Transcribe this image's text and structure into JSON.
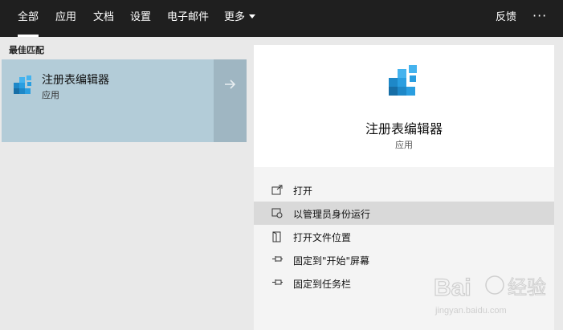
{
  "nav": {
    "tabs": [
      "全部",
      "应用",
      "文档",
      "设置",
      "电子邮件",
      "更多"
    ],
    "feedback": "反馈",
    "more_options": "···"
  },
  "best_match": {
    "title": "最佳匹配",
    "name": "注册表编辑器",
    "type": "应用"
  },
  "detail": {
    "name": "注册表编辑器",
    "type": "应用"
  },
  "actions": [
    {
      "label": "打开",
      "icon": "open-icon"
    },
    {
      "label": "以管理员身份运行",
      "icon": "admin-run-icon"
    },
    {
      "label": "打开文件位置",
      "icon": "file-location-icon"
    },
    {
      "label": "固定到\"开始\"屏幕",
      "icon": "pin-icon"
    },
    {
      "label": "固定到任务栏",
      "icon": "pin-icon"
    }
  ],
  "watermark": {
    "brand": "Baidu 经验",
    "url": "jingyan.baidu.com"
  },
  "colors": {
    "topbar": "#1f1f1f",
    "selected": "#b3ccd8",
    "accent": "#1e88c8"
  }
}
